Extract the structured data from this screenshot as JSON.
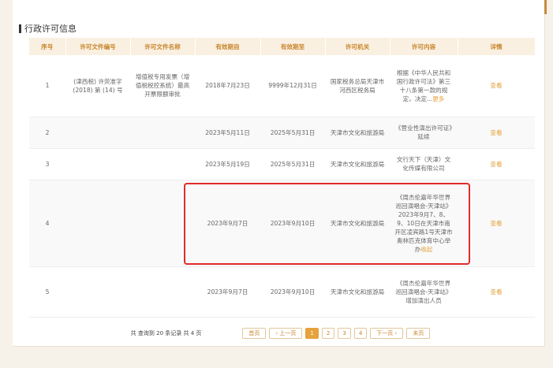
{
  "section_title": "行政许可信息",
  "columns": [
    "序号",
    "许可文件编号",
    "许可文件名称",
    "有效期自",
    "有效期至",
    "许可机关",
    "许可内容",
    "详情"
  ],
  "rows": [
    {
      "no": "1",
      "doc_no": "(津西税) 许荧准字 (2018) 第 (14) 号",
      "doc_name": "增值税专用发票（增值税税控系统）最高开票限额审批",
      "from": "2018年7月23日",
      "to": "9999年12月31日",
      "authority": "国家税务总局天津市河西区税务局",
      "content": "根据《中华人民共和国行政许可法》第三十八条第一款的规定，决定...",
      "content_link": "更多",
      "detail": "查看"
    },
    {
      "no": "2",
      "doc_no": "",
      "doc_name": "",
      "from": "2023年5月11日",
      "to": "2025年5月31日",
      "authority": "天津市文化和旅游局",
      "content": "《营业性演出许可证》延续",
      "content_link": "",
      "detail": "查看"
    },
    {
      "no": "3",
      "doc_no": "",
      "doc_name": "",
      "from": "2023年5月19日",
      "to": "2025年5月31日",
      "authority": "天津市文化和旅游局",
      "content": "文行天下（天津）文化传媒有限公司",
      "content_link": "",
      "detail": "查看"
    },
    {
      "no": "4",
      "doc_no": "",
      "doc_name": "",
      "from": "2023年9月7日",
      "to": "2023年9月10日",
      "authority": "天津市文化和旅游局",
      "content": "《周杰伦嘉年华世界巡回演唱会-天津站》2023年9月7、8、9、10日在天津市南开区凌宾路1号天津市奥林匹克体育中心举办",
      "content_link": "收起",
      "detail": "查看"
    },
    {
      "no": "5",
      "doc_no": "",
      "doc_name": "",
      "from": "2023年9月7日",
      "to": "2023年9月10日",
      "authority": "天津市文化和旅游局",
      "content": "《周杰伦嘉年华世界巡回演唱会-天津站》增加演出人员",
      "content_link": "",
      "detail": "查看"
    }
  ],
  "pager": {
    "info": "共 查询到 20 条记录 共 4 页",
    "first": "首页",
    "prev": "‹ 上一页",
    "pages": [
      "1",
      "2",
      "3",
      "4"
    ],
    "next": "下一页 ›",
    "last": "末页"
  }
}
